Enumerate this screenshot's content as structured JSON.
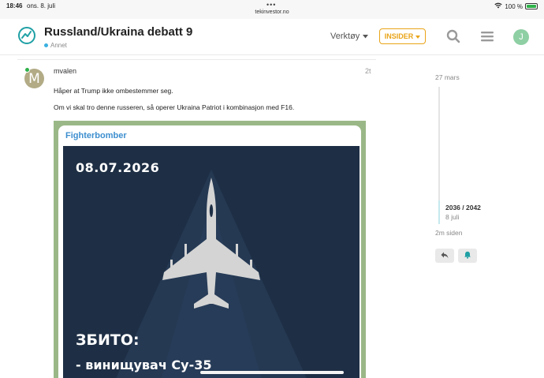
{
  "status": {
    "time": "18:46",
    "date": "ons. 8. juli",
    "url": "tekinvestor.no",
    "battery": "100 %",
    "battery_level": 1.0
  },
  "header": {
    "title": "Russland/Ukraina debatt 9",
    "category": "Annet",
    "tools_label": "Verktøy",
    "insider_label": "INSIDER",
    "user_initial": "J",
    "accent_color": "#1fa0a5",
    "insider_color": "#e9a417"
  },
  "post": {
    "avatar_letter": "M",
    "username": "mvalen",
    "time": "2t",
    "paragraphs": [
      "Håper at Trump ikke ombestemmer seg.",
      "Om vi skal tro denne russeren, så operer Ukraina Patriot i kombinasjon med F16."
    ],
    "image": {
      "channel": "Fighterbomber",
      "date": "08.07.2026",
      "line1": "ЗБИТО:",
      "line2": "- винищувач Су-35"
    }
  },
  "timeline": {
    "start": "27 mars",
    "position": "2036 / 2042",
    "current_date": "8 juli",
    "end": "2m siden"
  }
}
